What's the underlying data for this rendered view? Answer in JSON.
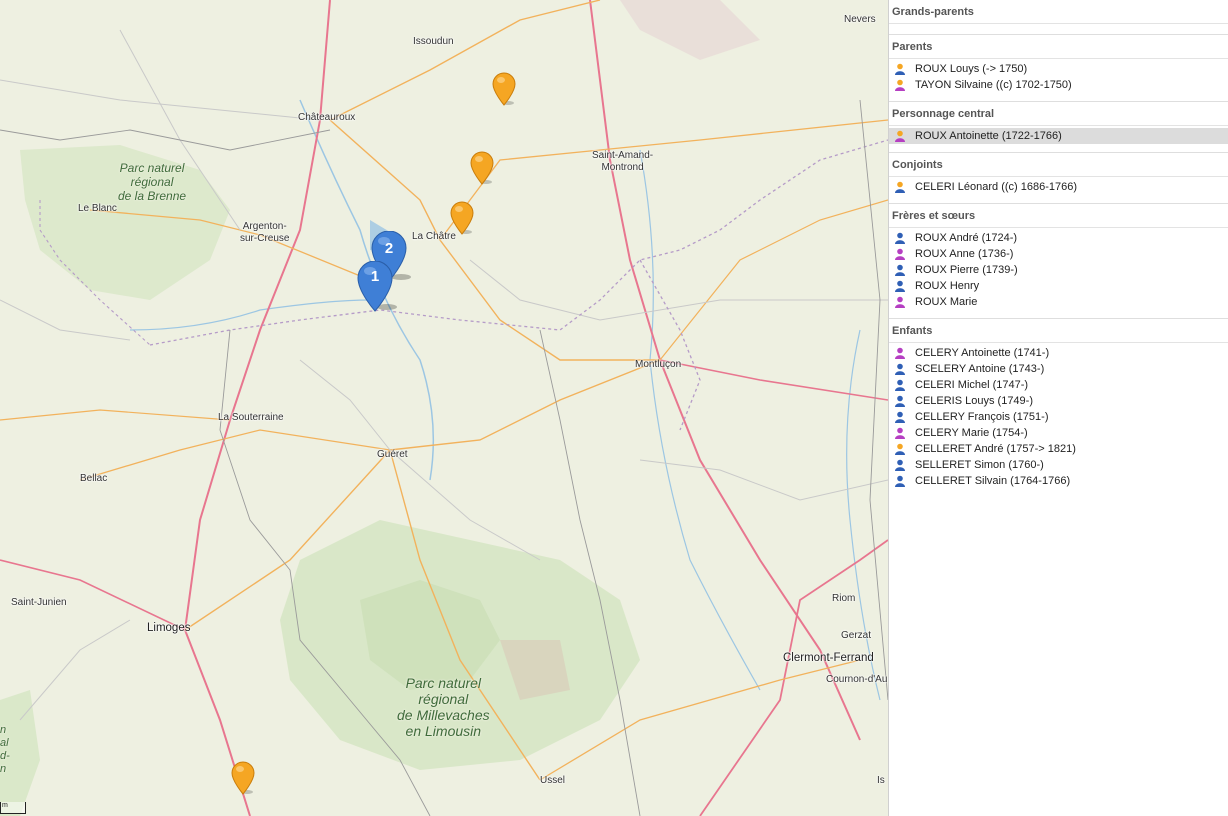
{
  "map": {
    "places": [
      {
        "id": "nevers",
        "label": "Nevers",
        "big": false
      },
      {
        "id": "issoudun",
        "label": "Issoudun",
        "big": false
      },
      {
        "id": "chateauroux",
        "label": "Châteauroux",
        "big": false
      },
      {
        "id": "saint-amand",
        "label": "Saint-Amand-\nMontrond",
        "big": false
      },
      {
        "id": "le-blanc",
        "label": "Le Blanc",
        "big": false
      },
      {
        "id": "argenton",
        "label": "Argenton-\nsur-Creuse",
        "big": false
      },
      {
        "id": "la-chatre",
        "label": "La Châtre",
        "big": false
      },
      {
        "id": "montlucon",
        "label": "Montluçon",
        "big": false
      },
      {
        "id": "la-souterraine",
        "label": "La Souterraine",
        "big": false
      },
      {
        "id": "gueret",
        "label": "Guéret",
        "big": false
      },
      {
        "id": "bellac",
        "label": "Bellac",
        "big": false
      },
      {
        "id": "saint-junien",
        "label": "Saint-Junien",
        "big": false
      },
      {
        "id": "limoges",
        "label": "Limoges",
        "big": true
      },
      {
        "id": "riom",
        "label": "Riom",
        "big": false
      },
      {
        "id": "gerzat",
        "label": "Gerzat",
        "big": false
      },
      {
        "id": "clermont",
        "label": "Clermont-Ferrand",
        "big": true
      },
      {
        "id": "cournon",
        "label": "Cournon-d'Au",
        "big": false
      },
      {
        "id": "ussel",
        "label": "Ussel",
        "big": false
      },
      {
        "id": "is",
        "label": "Is",
        "big": false
      }
    ],
    "parks": [
      {
        "id": "brenne",
        "label": "Parc naturel\nrégional\nde la Brenne"
      },
      {
        "id": "millevaches",
        "label": "Parc naturel\nrégional\nde Millevaches\nen Limousin"
      },
      {
        "id": "edge-park",
        "label": "n\nal\nd-\nn"
      }
    ],
    "clusters": [
      {
        "id": "cluster-2",
        "count": "2"
      },
      {
        "id": "cluster-1",
        "count": "1"
      }
    ],
    "markers": [
      "marker-1",
      "marker-2",
      "marker-3",
      "marker-4"
    ],
    "scale_label": "m",
    "colors": {
      "marker_orange": "#f5a623",
      "cluster_blue": "#3f7fd6"
    }
  },
  "panel": {
    "sections": [
      {
        "title": "Grands-parents",
        "people": []
      },
      {
        "title": "Parents",
        "people": [
          {
            "name": "ROUX Louys (-> 1750)",
            "icon": "person-orange"
          },
          {
            "name": "TAYON Silvaine ((c) 1702-1750)",
            "icon": "person-orange-female"
          }
        ]
      },
      {
        "title": "Personnage central",
        "people": [
          {
            "name": "ROUX Antoinette (1722-1766)",
            "icon": "person-orange-female",
            "selected": true
          }
        ]
      },
      {
        "title": "Conjoints",
        "people": [
          {
            "name": "CELERI Léonard ((c) 1686-1766)",
            "icon": "person-orange"
          }
        ]
      },
      {
        "title": "Frères et sœurs",
        "people": [
          {
            "name": "ROUX André (1724-)",
            "icon": "person-blue"
          },
          {
            "name": "ROUX Anne (1736-)",
            "icon": "person-purple"
          },
          {
            "name": "ROUX Pierre (1739-)",
            "icon": "person-blue"
          },
          {
            "name": "ROUX Henry",
            "icon": "person-blue"
          },
          {
            "name": "ROUX Marie",
            "icon": "person-purple"
          }
        ]
      },
      {
        "title": "Enfants",
        "people": [
          {
            "name": "CELERY Antoinette (1741-)",
            "icon": "person-purple"
          },
          {
            "name": "SCELERY Antoine (1743-)",
            "icon": "person-blue"
          },
          {
            "name": "CELERI Michel (1747-)",
            "icon": "person-blue"
          },
          {
            "name": "CELERIS Louys (1749-)",
            "icon": "person-blue"
          },
          {
            "name": "CELLERY François (1751-)",
            "icon": "person-blue"
          },
          {
            "name": "CELERY Marie (1754-)",
            "icon": "person-purple"
          },
          {
            "name": "CELLERET André (1757-> 1821)",
            "icon": "person-orange"
          },
          {
            "name": "SELLERET Simon (1760-)",
            "icon": "person-blue"
          },
          {
            "name": "CELLERET Silvain (1764-1766)",
            "icon": "person-blue"
          }
        ]
      }
    ]
  }
}
